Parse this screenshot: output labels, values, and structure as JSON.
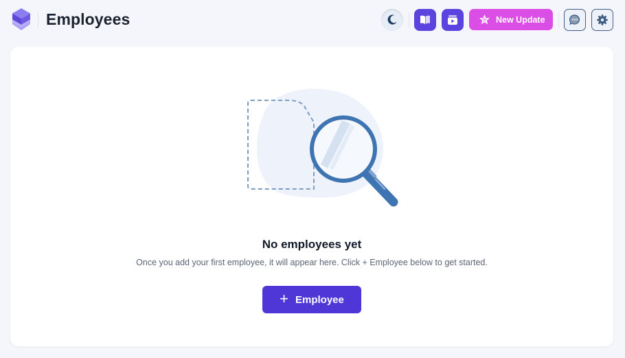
{
  "header": {
    "title": "Employees",
    "logo_icon": "cube-logo-icon",
    "theme_toggle_icon": "moon-icon",
    "docs_icon": "book-icon",
    "video_icon": "video-icon",
    "update_button": {
      "label": "New Update",
      "icon": "sparkle-star-icon"
    },
    "chat_icon": "chat-bubble-icon",
    "settings_icon": "gear-icon"
  },
  "empty_state": {
    "illustration_icon": "magnifying-glass-icon",
    "title": "No employees yet",
    "description": "Once you add your first employee, it will appear here. Click + Employee below to get started.",
    "button": {
      "icon": "plus-icon",
      "label": "Employee"
    }
  },
  "colors": {
    "primary": "#4f36d6",
    "accent_pink": "#da4ee6",
    "icon_purple": "#5b43e0",
    "background": "#f4f6fb",
    "card": "#ffffff",
    "illustration_blue": "#3f74b3"
  }
}
